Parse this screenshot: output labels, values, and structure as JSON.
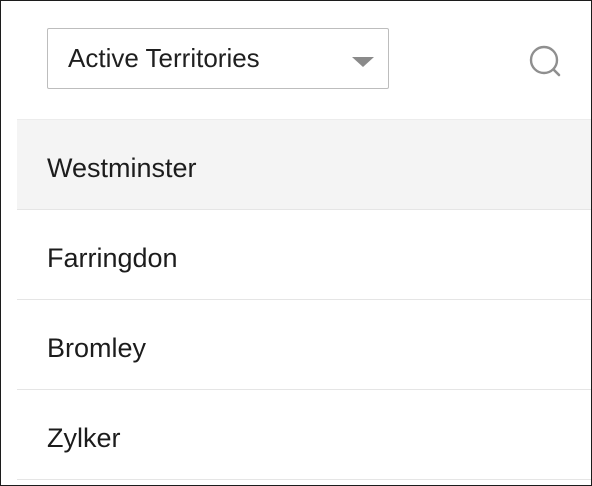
{
  "filter": {
    "selected": "Active Territories"
  },
  "search": {
    "icon": "search-icon"
  },
  "territories": [
    {
      "label": "Westminster",
      "selected": true
    },
    {
      "label": "Farringdon",
      "selected": false
    },
    {
      "label": "Bromley",
      "selected": false
    },
    {
      "label": "Zylker",
      "selected": false
    }
  ]
}
